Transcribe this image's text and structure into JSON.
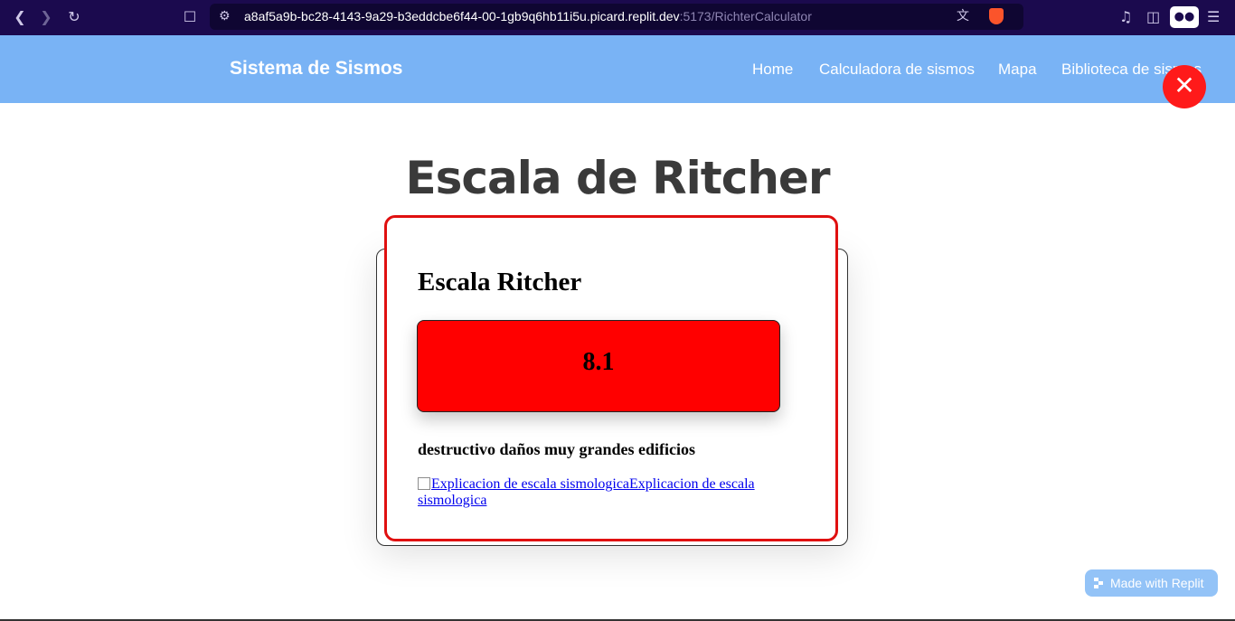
{
  "browser": {
    "url_host": "a8af5a9b-bc28-4143-9a29-b3eddcbe6f44-00-1gb9q6hb11i5u.picard.replit.dev",
    "url_path": ":5173/RichterCalculator"
  },
  "site": {
    "brand": "Sistema de Sismos",
    "nav": [
      "Home",
      "Calculadora de sismos",
      "Mapa",
      "Biblioteca de sismos"
    ]
  },
  "page": {
    "title": "Escala de Ritcher"
  },
  "card": {
    "title": "Escala Ritcher",
    "value": "8.1",
    "value_color": "#ff0000",
    "description": "destructivo daños muy grandes edificios",
    "image_alt": "Explicacion de escala sismologica",
    "link_text": "Explicacion de escala sismologica"
  },
  "badge": {
    "label": "Made with Replit"
  },
  "colors": {
    "nav_bg": "#79b3f5",
    "close_button": "#ff1a1a",
    "highlight_border": "#e01010"
  }
}
